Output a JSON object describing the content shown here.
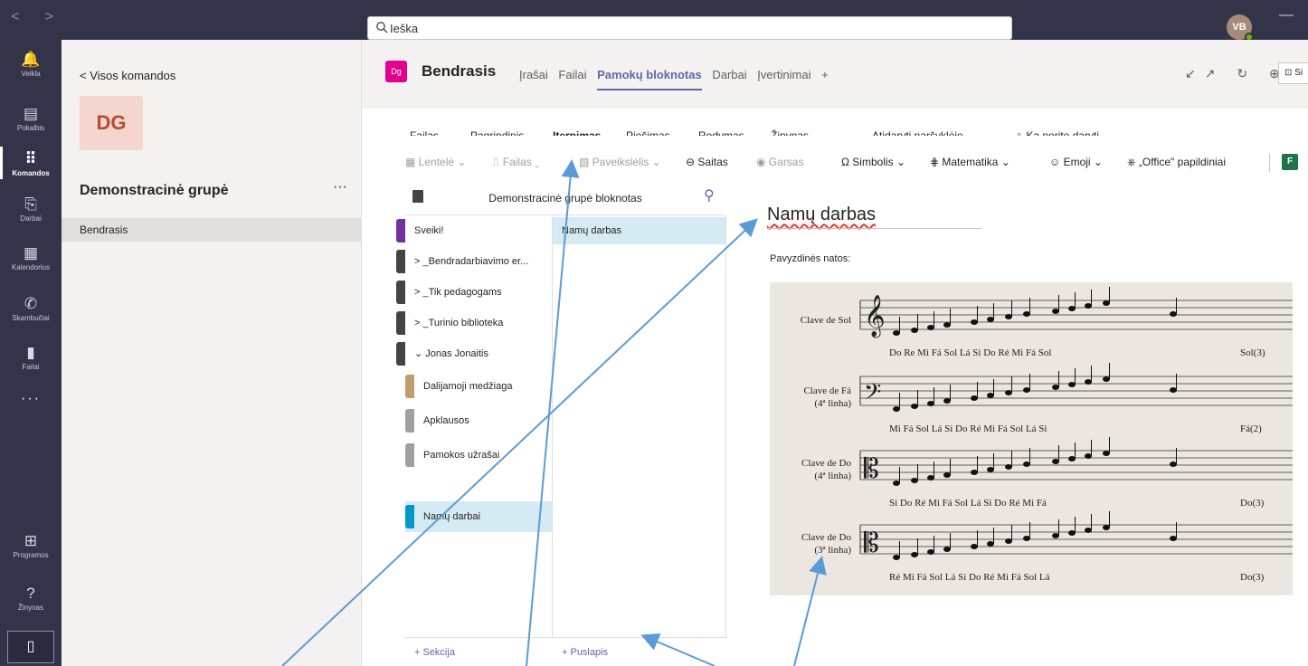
{
  "titlebar": {
    "nav": "< >",
    "search_placeholder": "Ieška",
    "avatar": "VB",
    "minimize": "—"
  },
  "rail": [
    {
      "label": "Veikla",
      "icon": "bell-icon",
      "glyph": "🔔"
    },
    {
      "label": "Pokalbis",
      "icon": "chat-icon",
      "glyph": "▤"
    },
    {
      "label": "Komandos",
      "icon": "teams-icon",
      "glyph": "⠿"
    },
    {
      "label": "Darbai",
      "icon": "assignments-icon",
      "glyph": "⎘"
    },
    {
      "label": "Kalendorius",
      "icon": "calendar-icon",
      "glyph": "▦"
    },
    {
      "label": "Skambučiai",
      "icon": "phone-icon",
      "glyph": "✆"
    },
    {
      "label": "Failai",
      "icon": "file-icon",
      "glyph": "▮"
    }
  ],
  "rail_more": "···",
  "rail_bottom": [
    {
      "label": "Programos",
      "icon": "apps-icon",
      "glyph": "⊞"
    },
    {
      "label": "Žinynas",
      "icon": "help-icon",
      "glyph": "?"
    }
  ],
  "rail_device": "▯",
  "teams_panel": {
    "back": "<  Visos komandos",
    "tile": "DG",
    "team_name": "Demonstracinė grupė",
    "more": "···",
    "channel": "Bendrasis"
  },
  "header": {
    "badge": "Dg",
    "title": "Bendrasis",
    "tabs": [
      "Įrašai",
      "Failai",
      "Pamokų bloknotas",
      "Darbai",
      "Įvertinimai",
      "+"
    ],
    "icons": "↙↗ ↻ ⊕",
    "button": "⊡ Si"
  },
  "ribbon": {
    "items": [
      "Failas",
      "Pagrindinis",
      "Įterpimas",
      "Piešimas",
      "Rodymas",
      "Žinynas  ⌄",
      "Atidaryti naršyklėje ⌄",
      "♀  Ką norite daryti"
    ]
  },
  "tools": {
    "items": [
      "▦ Lentelė ⌄",
      "⎍ Failas ⌄",
      "▧ Paveikslėlis ⌄",
      "⊖ Saitas",
      "◉ Garsas",
      "Ω Simbolis ⌄",
      "⋕ Matematika ⌄",
      "☺ Emoji ⌄",
      "⎈ „Office\" papildiniai",
      "F"
    ]
  },
  "notebook": {
    "title": "Demonstracinė grupė bloknotas",
    "sections": [
      {
        "label": "Sveiki!",
        "color": "#7030a0"
      },
      {
        "label": ">  _Bendradarbiavimo er...",
        "color": "#444444"
      },
      {
        "label": ">  _Tik pedagogams",
        "color": "#444444"
      },
      {
        "label": ">  _Turinio biblioteka",
        "color": "#444444"
      },
      {
        "label": "⌄  Jonas Jonaitis",
        "color": "#444444"
      },
      {
        "label": "Dalijamoji medžiaga",
        "color": "#c19c6c"
      },
      {
        "label": "Apklausos",
        "color": "#a0a0a0"
      },
      {
        "label": "Pamokos užrašai",
        "color": "#a0a0a0"
      },
      {
        "label": "Namų darbai",
        "color": "#0099cc"
      }
    ],
    "page": "Namų darbas",
    "add_section": "+ Sekcija",
    "add_page": "+ Puslapis"
  },
  "page": {
    "title": "Namų darbas",
    "subtitle": "Pavyzdinės natos:"
  },
  "score": {
    "rows": [
      {
        "label": "Clave de Sol",
        "sub": "",
        "notes": "Do  Re  Mi  Fá    Sol  Lá   Si  Do    Ré  Mi  Fá  Sol",
        "last": "Sol(3)",
        "clef": "𝄞"
      },
      {
        "label": "Clave de Fá",
        "sub": "(4ª linha)",
        "notes": "Mi  Fá  Sol  Lá    Si  Do  Ré  Mi    Fá  Sol  Lá  Si",
        "last": "Fá(2)",
        "clef": "𝄢"
      },
      {
        "label": "Clave de Do",
        "sub": "(4ª linha)",
        "notes": "Si  Do  Ré  Mi    Fá  Sol  Lá  Si    Do  Ré  Mi  Fá",
        "last": "Do(3)",
        "clef": "𝄡"
      },
      {
        "label": "Clave de Do",
        "sub": "(3ª linha)",
        "notes": "Ré  Mi  Fá  Sol    Lá  Si  Do  Ré    Mi  Fá  Sol  Lá",
        "last": "Do(3)",
        "clef": "𝄡"
      }
    ]
  }
}
